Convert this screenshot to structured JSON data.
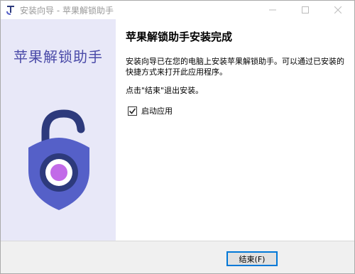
{
  "window": {
    "title": "安装向导 - 苹果解锁助手"
  },
  "sidebar": {
    "title": "苹果解锁助手",
    "illustration_icon": "lock-shield-icon"
  },
  "content": {
    "heading": "苹果解锁助手安装完成",
    "description": "安装向导已在您的电脑上安装苹果解锁助手。可以通过已安装的快捷方式来打开此应用程序。",
    "hint": "点击\"结束\"退出安装。",
    "launch_checkbox": {
      "label": "启动应用",
      "checked": true
    }
  },
  "footer": {
    "finish_label": "结束(F)"
  },
  "colors": {
    "accent": "#4a4aa8",
    "sidebar_bg": "#e8e8f8",
    "shield": "#5560c8",
    "lock_shackle": "#2d3a7c",
    "lock_core": "#c26ae8",
    "button_border": "#0078d7"
  }
}
